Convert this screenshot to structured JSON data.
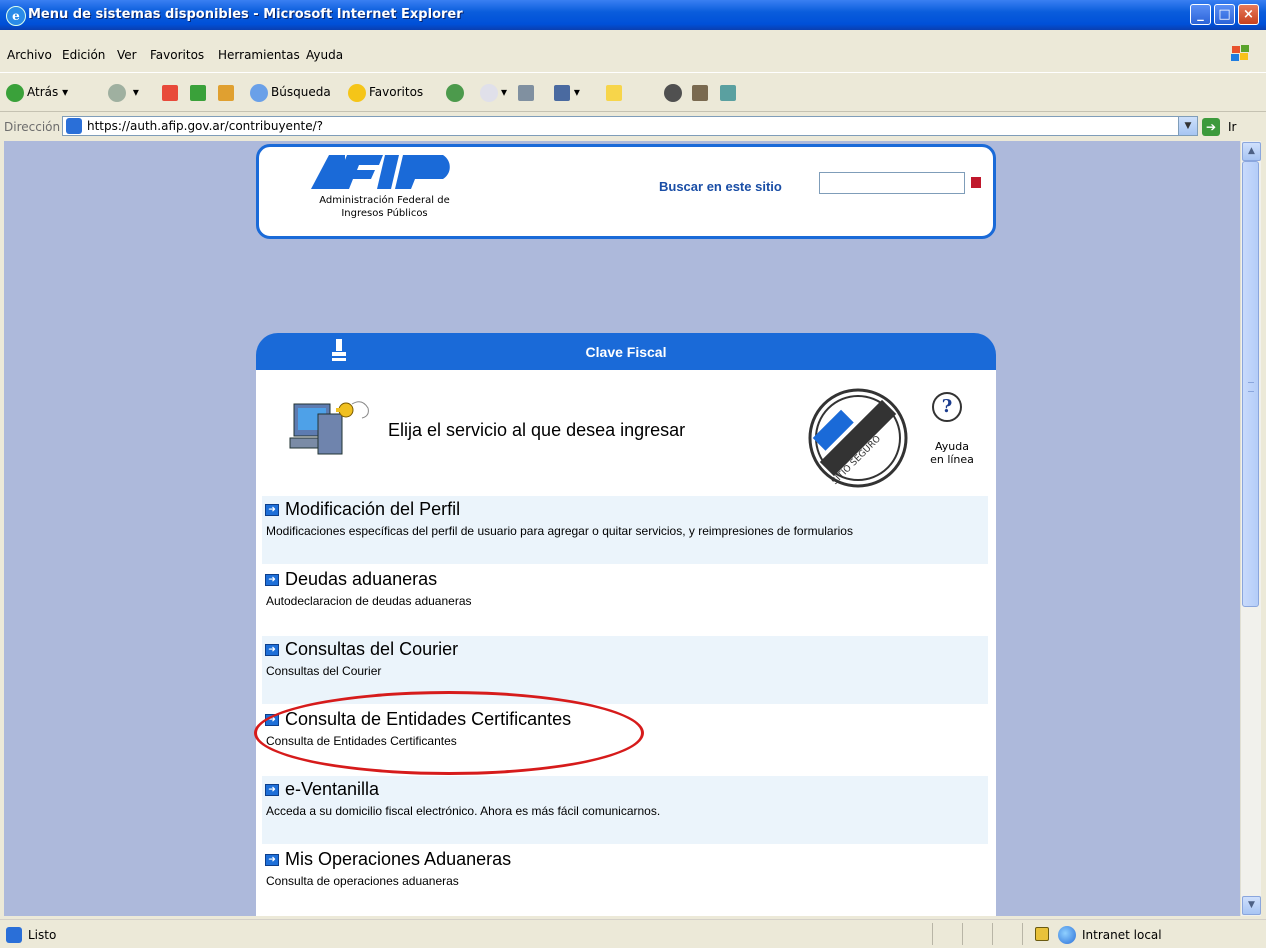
{
  "window": {
    "title": "Menu de sistemas disponibles - Microsoft Internet Explorer"
  },
  "menu": [
    "Archivo",
    "Edición",
    "Ver",
    "Favoritos",
    "Herramientas",
    "Ayuda"
  ],
  "toolbar": {
    "back": "Atrás",
    "search": "Búsqueda",
    "favorites": "Favoritos"
  },
  "address": {
    "label": "Dirección",
    "url": "https://auth.afip.gov.ar/contribuyente/?",
    "go": "Ir"
  },
  "header": {
    "org_line1": "Administración Federal de",
    "org_line2": "Ingresos Públicos",
    "search_label": "Buscar en este sitio",
    "search_value": ""
  },
  "panel": {
    "heading": "Clave Fiscal",
    "title": "Elija el servicio al que desea ingresar",
    "seal_text": "SITIO SEGURO",
    "help_line1": "Ayuda",
    "help_line2": "en línea"
  },
  "services": [
    {
      "name": "Modificación del Perfil",
      "desc": "Modificaciones específicas del perfil de usuario para agregar o quitar servicios, y reimpresiones de formularios"
    },
    {
      "name": "Deudas aduaneras",
      "desc": "Autodeclaracion de deudas aduaneras"
    },
    {
      "name": "Consultas del Courier",
      "desc": "Consultas del Courier"
    },
    {
      "name": "Consulta de Entidades Certificantes",
      "desc": "Consulta de Entidades Certificantes"
    },
    {
      "name": "e-Ventanilla",
      "desc": "Acceda a su domicilio fiscal electrónico. Ahora es más fácil comunicarnos."
    },
    {
      "name": "Mis Operaciones Aduaneras",
      "desc": "Consulta de operaciones aduaneras"
    }
  ],
  "status": {
    "text": "Listo",
    "zone": "Intranet local"
  },
  "colors": {
    "accent": "#1a6ad8",
    "background": "#adb9db",
    "highlight": "#d61b1b",
    "row_alt": "#ebf4fb"
  }
}
